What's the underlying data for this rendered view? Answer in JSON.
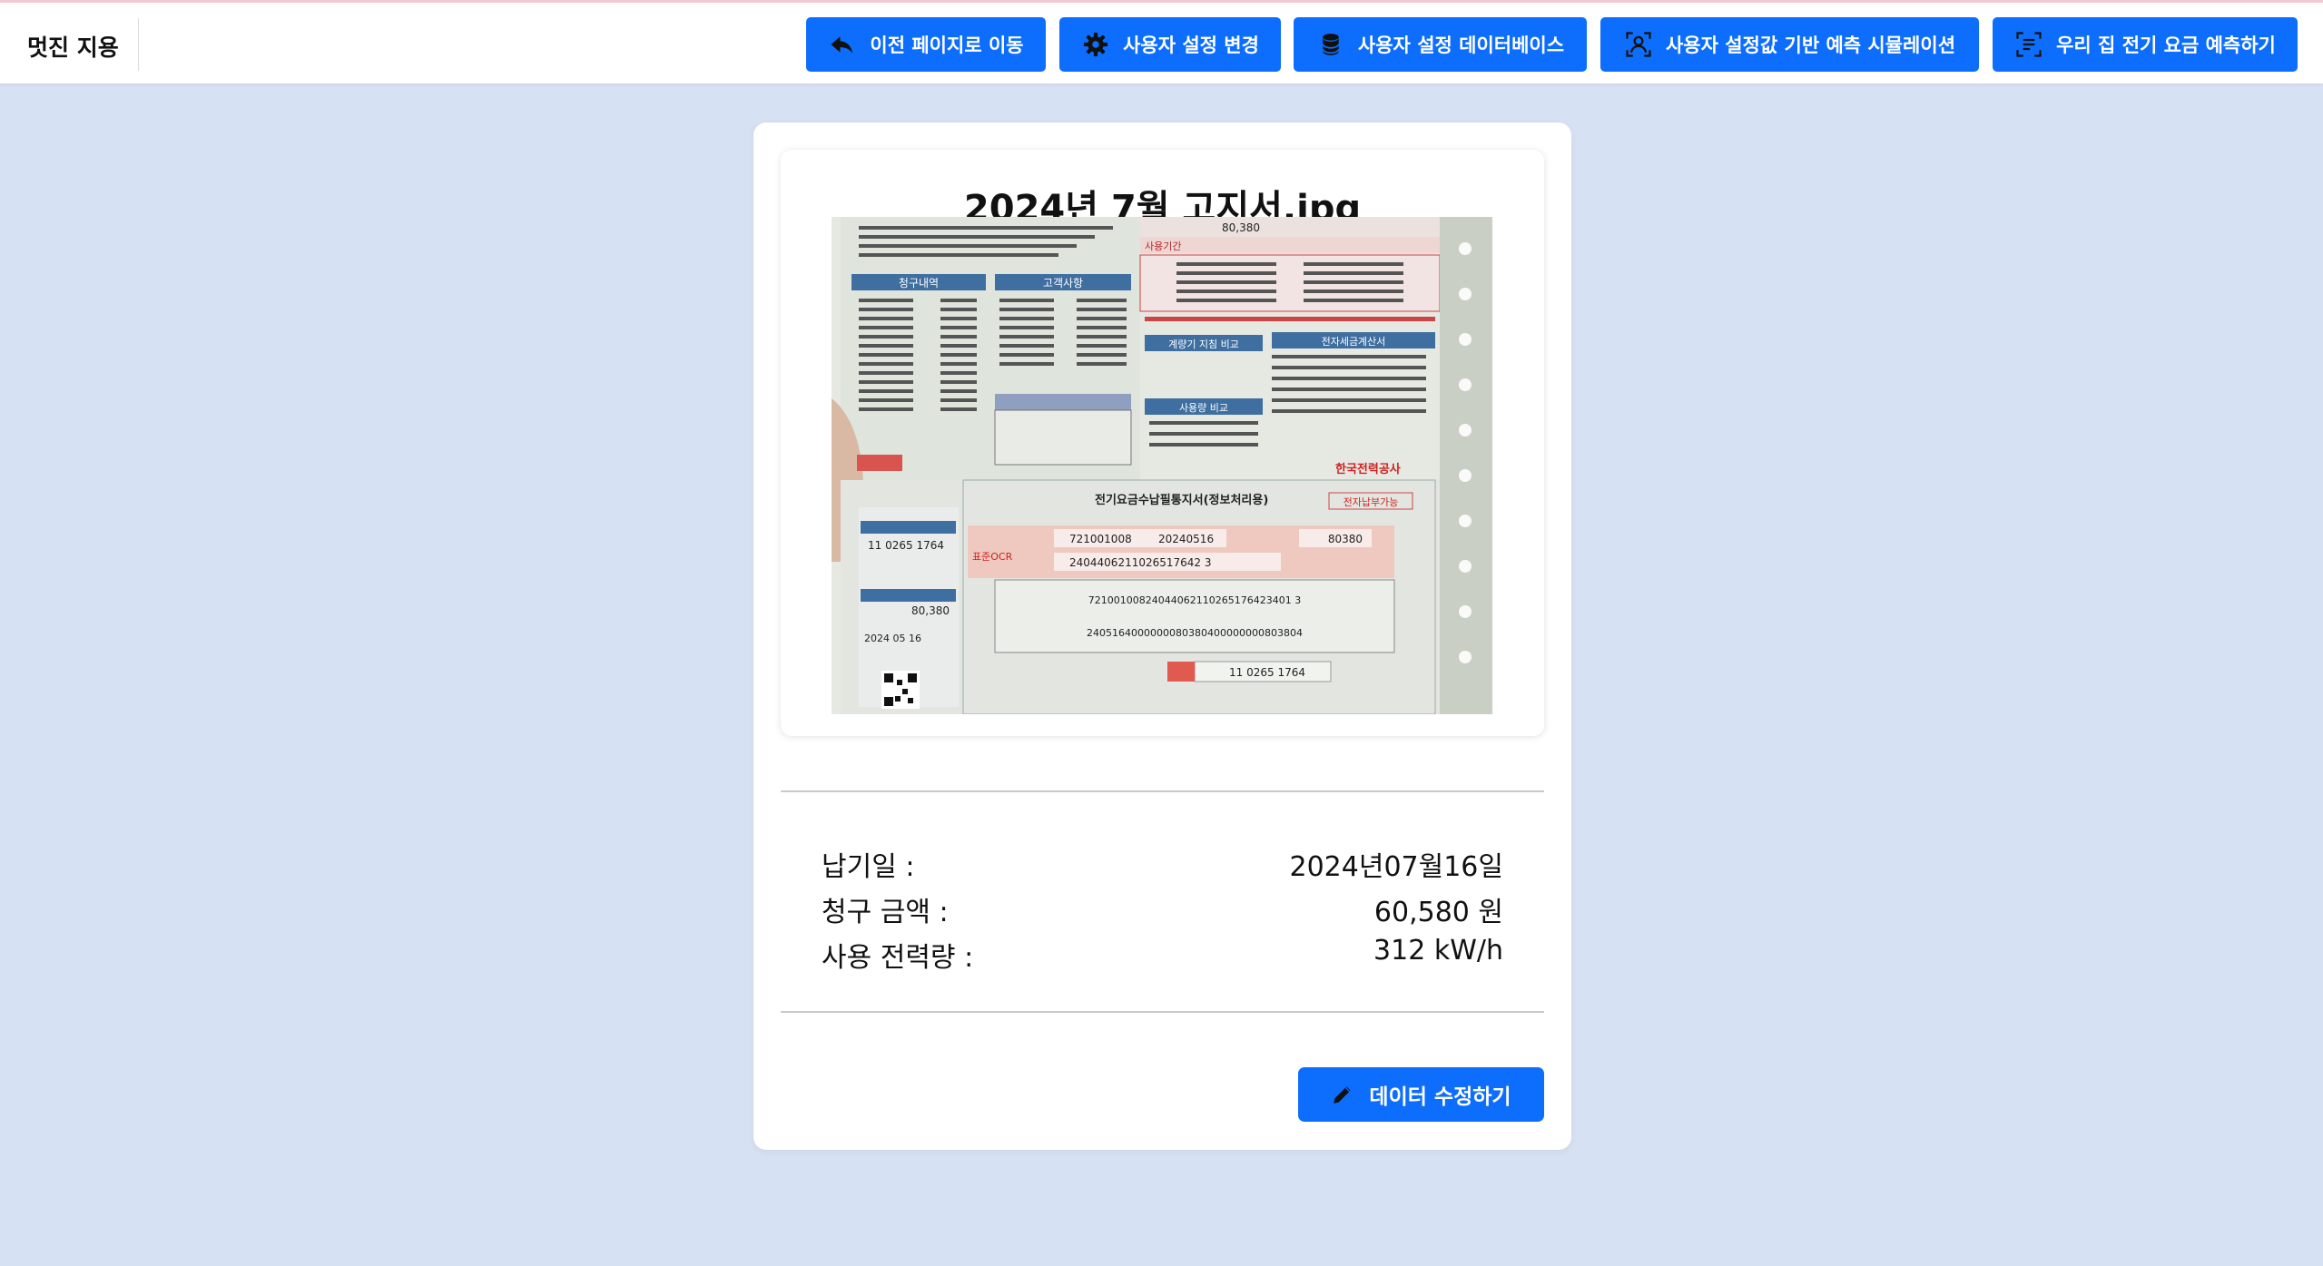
{
  "header": {
    "brand": "멋진 지용",
    "nav": [
      {
        "label": "이전 페이지로 이동",
        "icon": "reply-arrow-icon"
      },
      {
        "label": "사용자 설정 변경",
        "icon": "gear-icon"
      },
      {
        "label": "사용자 설정 데이터베이스",
        "icon": "database-icon"
      },
      {
        "label": "사용자 설정값 기반 예측 시뮬레이션",
        "icon": "user-scan-icon"
      },
      {
        "label": "우리 집 전기 요금 예측하기",
        "icon": "document-scan-icon"
      }
    ]
  },
  "bill": {
    "filename": "2024년 7월 고지서.jpg",
    "image_texts": {
      "billing_detail_header": "청구내역",
      "customer_info_header": "고객사항",
      "amount_top": "80,380",
      "usage_period_label": "사용기간",
      "meter_header": "계량기 지침 비교",
      "usage_compare_header": "사용량 비교",
      "tax_header": "전자세금계산서",
      "slip_title": "전기요금수납필통지서(정보처리용)",
      "e_payment": "전자납부가능",
      "ocr_label": "표준OCR",
      "code_a": "721001008",
      "code_b": "20240516",
      "amount_a": "80380",
      "account_no": "2404406211026517642 3",
      "customer_no": "11 0265 1764",
      "amount_left": "80,380",
      "due_left": "2024 05 16",
      "barcode_line1": "72100100824044062110265176423401 3",
      "barcode_line2": "2405164000000080380400000000803804",
      "kepco": "한국전력공사",
      "customer_no_bottom": "11 0265 1764"
    }
  },
  "summary": {
    "due_date_label": "납기일 :",
    "due_date_value": "2024년07월16일",
    "amount_label": "청구 금액 :",
    "amount_value": "60,580 원",
    "usage_label": "사용 전력량 :",
    "usage_value": "312 kW/h"
  },
  "actions": {
    "edit_label": "데이터 수정하기"
  },
  "colors": {
    "accent": "#0d6efd",
    "background": "#d6e2f3"
  }
}
